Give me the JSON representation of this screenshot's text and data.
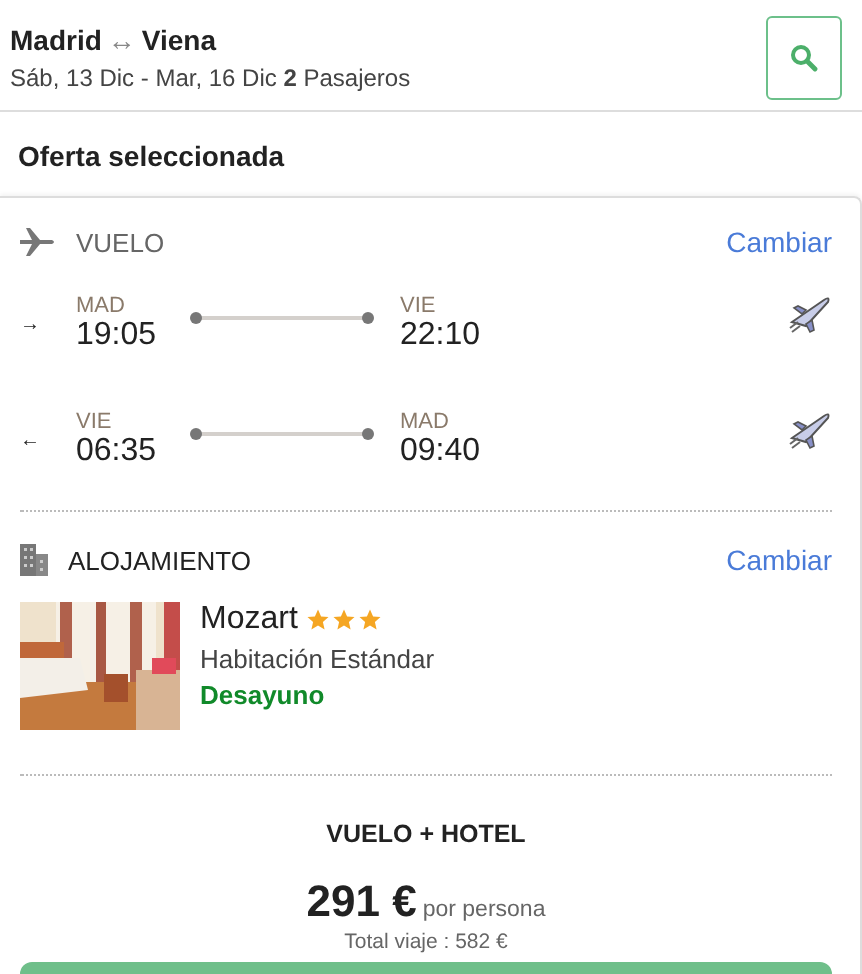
{
  "search": {
    "origin": "Madrid",
    "route_arrow": "↔",
    "destination": "Viena",
    "details": "Sáb, 13 Dic - Mar, 16 Dic **2** Pasajeros"
  },
  "section_title": "Oferta seleccionada",
  "flight": {
    "title": "VUELO",
    "change_link": "Cambiar",
    "legs": [
      {
        "direction": "→",
        "from_code": "MAD",
        "from_time": "19:05",
        "to_code": "VIE",
        "to_time": "22:10"
      },
      {
        "direction": "←",
        "from_code": "VIE",
        "from_time": "06:35",
        "to_code": "MAD",
        "to_time": "09:40"
      }
    ]
  },
  "accommodation": {
    "title": "ALOJAMIENTO",
    "change_link": "Cambiar",
    "hotel_name": "Mozart",
    "stars": 3,
    "room": "Habitación Estándar",
    "board": "Desayuno"
  },
  "price": {
    "heading": "VUELO + HOTEL",
    "amount": "291 €",
    "per": "por persona",
    "total": "Total viaje : 582 €"
  }
}
